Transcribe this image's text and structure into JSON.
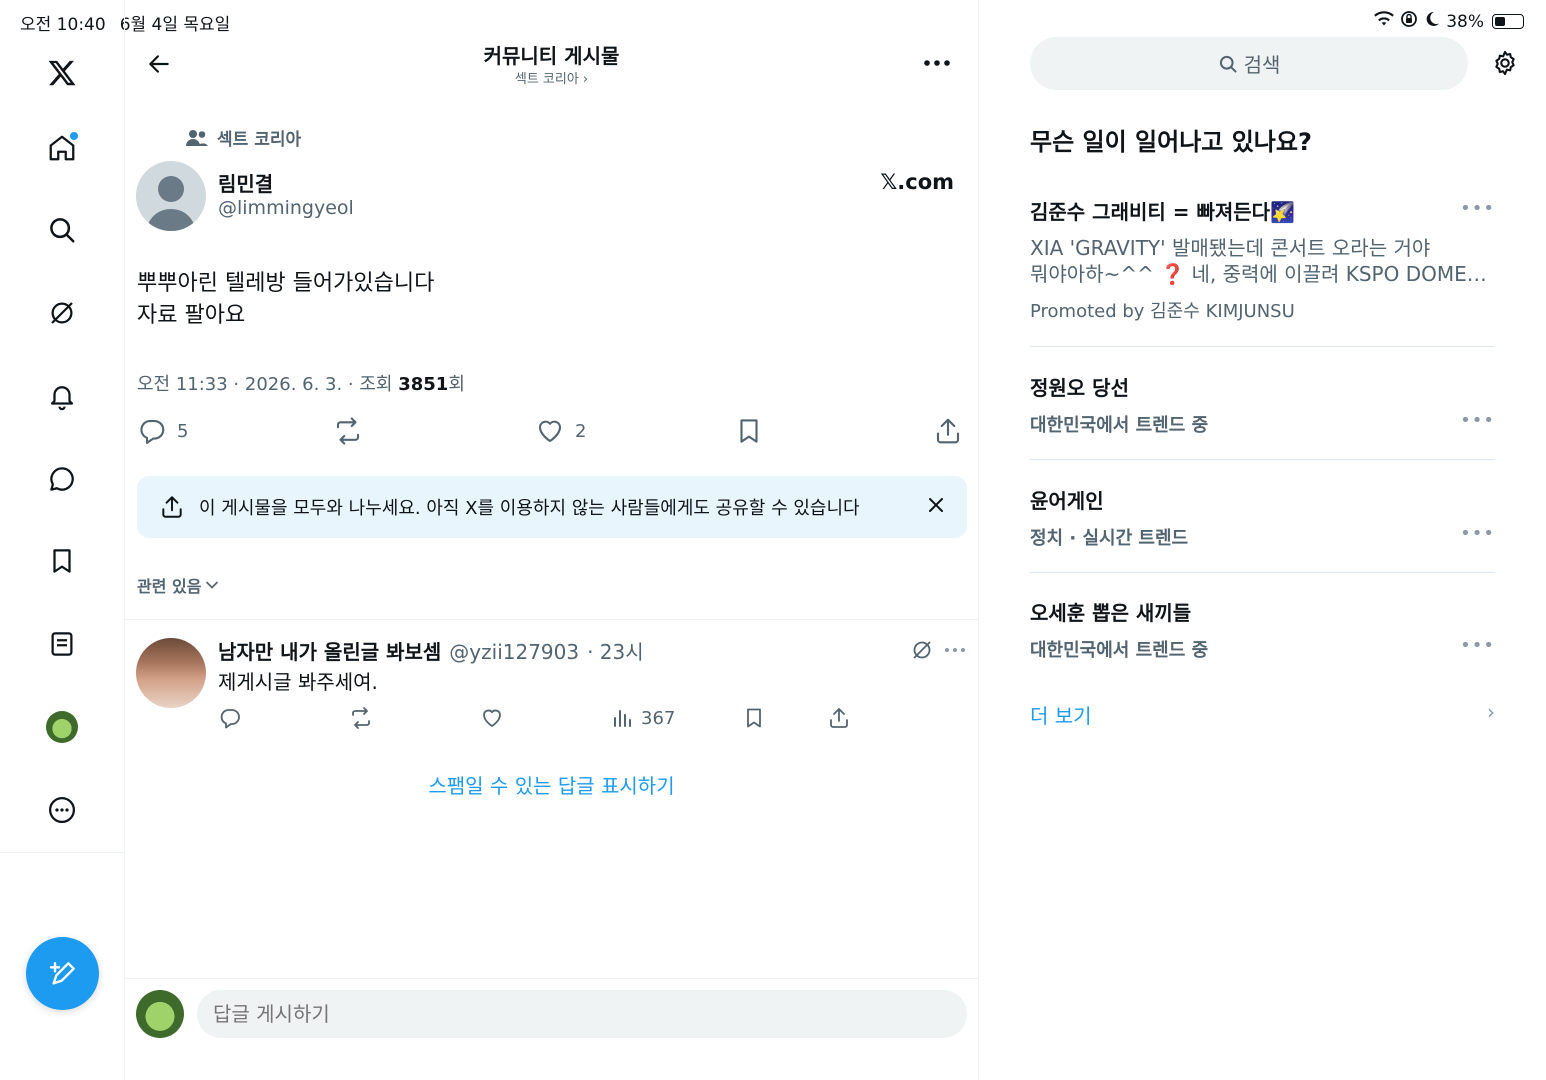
{
  "status_bar": {
    "time": "오전 10:40",
    "date": "6월 4일 목요일",
    "battery": "38%",
    "battery_level": 0.38
  },
  "nav": {
    "items": [
      "x-logo",
      "home",
      "search",
      "grok",
      "notifications",
      "messages",
      "bookmarks",
      "lists",
      "profile",
      "more"
    ],
    "compose": "compose-post"
  },
  "header": {
    "title": "커뮤니티 게시물",
    "subtitle": "섹트 코리아 ›"
  },
  "post": {
    "community": "섹트 코리아",
    "author_name": "림민결",
    "author_handle": "@limmingyeol",
    "source": "𝕏.com",
    "text": "뿌뿌아린 텔레방 들어가있습니다\n자료 팔아요",
    "meta_prefix": "오전 11:33 · 2026. 6. 3. · 조회 ",
    "views": "3851",
    "meta_suffix": "회",
    "replies": "5",
    "likes": "2"
  },
  "share_banner": {
    "text": "이 게시물을 모두와 나누세요. 아직 X를 이용하지 않는 사람들에게도 공유할 수 있습니다"
  },
  "sort": {
    "label": "관련 있음"
  },
  "reply": {
    "name": "남자만 내가 올린글 봐보셈",
    "handle": "@yzii127903",
    "time": "· 23시",
    "text": "제게시글 봐주세여.",
    "views": "367"
  },
  "spam_link": "스팸일 수 있는 답글 표시하기",
  "reply_input": {
    "placeholder": "답글 게시하기"
  },
  "search": {
    "placeholder": "검색"
  },
  "trends": {
    "title": "무슨 일이 일어나고 있나요?",
    "promoted": {
      "title": "김준수 그래비티 = 빠져든다🌠",
      "description": "XIA 'GRAVITY' 발매됐는데 콘서트 오라는 거야\n뭐야아하~^^ ❓ 네, 중력에 이끌려 KSPO DOME…",
      "promoted_by": "Promoted by 김준수 KIMJUNSU"
    },
    "items": [
      {
        "title": "정원오 당선",
        "sub": "대한민국에서 트렌드 중"
      },
      {
        "title": "윤어게인",
        "sub": "정치 · 실시간 트렌드"
      },
      {
        "title": "오세훈 뽑은 새끼들",
        "sub": "대한민국에서 트렌드 중"
      }
    ],
    "show_more": "더 보기"
  },
  "colors": {
    "accent": "#1d9bf0",
    "text": "#0f1419",
    "secondary": "#536471",
    "banner_bg": "#e8f5fd"
  }
}
